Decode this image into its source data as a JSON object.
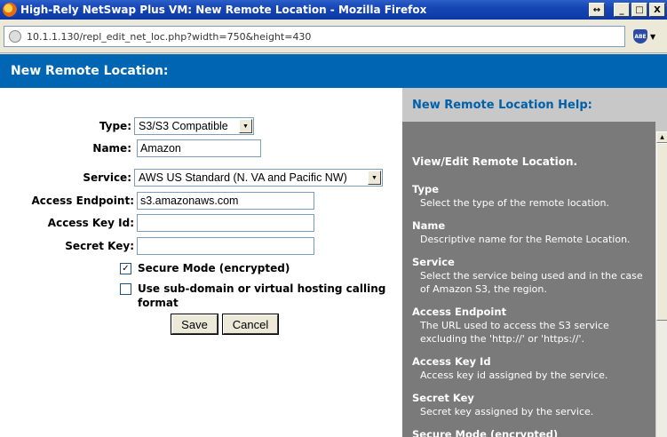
{
  "window": {
    "title": "High-Rely NetSwap Plus VM: New Remote Location - Mozilla Firefox",
    "buttons": {
      "extra": "↔",
      "minimize": "_",
      "maximize": "□",
      "close": "X"
    }
  },
  "address": {
    "url": "10.1.1.130/repl_edit_net_loc.php?width=750&height=430",
    "addon": "ABE"
  },
  "page": {
    "header": "New Remote Location:"
  },
  "form": {
    "type_label": "Type:",
    "type_value": "S3/S3 Compatible",
    "name_label": "Name:",
    "name_value": "Amazon",
    "service_label": "Service:",
    "service_value": "AWS US Standard (N. VA and Pacific NW)",
    "endpoint_label": "Access Endpoint:",
    "endpoint_value": "s3.amazonaws.com",
    "keyid_label": "Access Key Id:",
    "keyid_value": "",
    "secret_label": "Secret Key:",
    "secret_value": "",
    "secure_label": "Secure Mode (encrypted)",
    "secure_checked": true,
    "subdomain_label": "Use sub-domain or virtual hosting calling format",
    "subdomain_checked": false,
    "save_label": "Save",
    "cancel_label": "Cancel"
  },
  "help": {
    "header": "New Remote Location Help:",
    "title": "View/Edit Remote Location.",
    "items": [
      {
        "h": "Type",
        "d": "Select the type of the remote location."
      },
      {
        "h": "Name",
        "d": "Descriptive name for the Remote Location."
      },
      {
        "h": "Service",
        "d": "Select the service being used and in the case of Amazon S3, the region."
      },
      {
        "h": "Access Endpoint",
        "d": "The URL used to access the S3 service excluding the 'http://' or 'https://'."
      },
      {
        "h": "Access Key Id",
        "d": "Access key id assigned by the service."
      },
      {
        "h": "Secret Key",
        "d": "Secret key assigned by the service."
      },
      {
        "h": "Secure Mode (encrypted)",
        "d": ""
      }
    ]
  },
  "colors": {
    "header_blue": "#0066b3",
    "help_bg": "#7a7a7a",
    "help_header_text": "#0060a8"
  }
}
